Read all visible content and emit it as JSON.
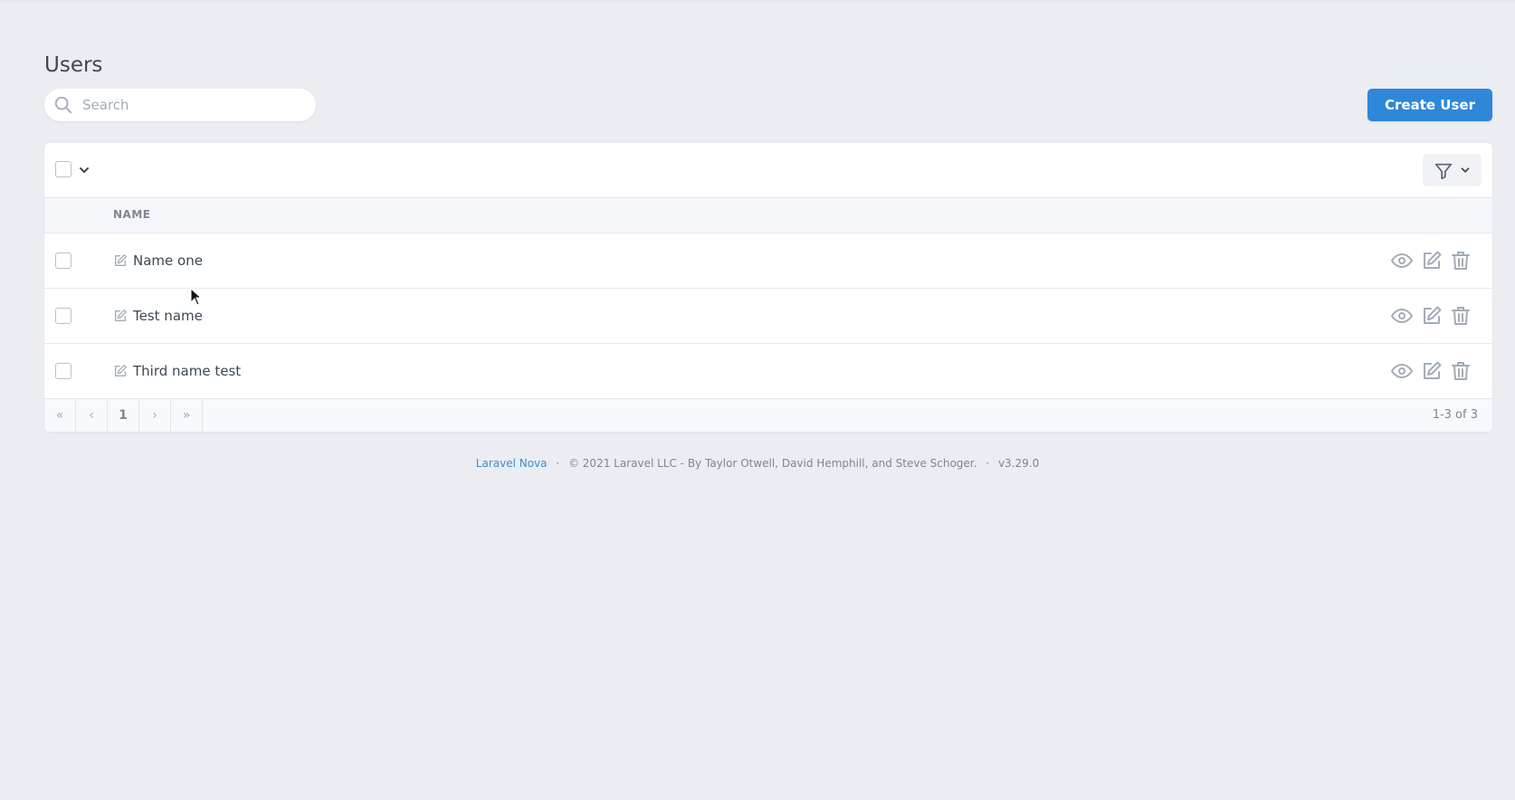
{
  "page": {
    "title": "Users"
  },
  "search": {
    "placeholder": "Search",
    "value": ""
  },
  "toolbar": {
    "create_label": "Create User"
  },
  "table": {
    "columns": [
      "NAME"
    ],
    "rows": [
      {
        "name": "Name one"
      },
      {
        "name": "Test name"
      },
      {
        "name": "Third name test"
      }
    ]
  },
  "pagination": {
    "first": "«",
    "prev": "‹",
    "current": "1",
    "next": "›",
    "last": "»",
    "count": "1-3 of 3"
  },
  "footer": {
    "brand": "Laravel Nova",
    "copyright": "© 2021 Laravel LLC - By Taylor Otwell, David Hemphill, and Steve Schoger.",
    "version": "v3.29.0",
    "separator": "·"
  },
  "icons": {
    "search": "search-icon",
    "filter": "filter-icon",
    "chevron": "chevron-down-icon",
    "view": "eye-icon",
    "edit": "edit-icon",
    "delete": "trash-icon"
  },
  "colors": {
    "background": "#ebedf2",
    "primary": "#2f87d8",
    "link": "#3a8fd0",
    "text": "#3d4852",
    "muted": "#7e8791",
    "icon": "#a3acb7"
  }
}
